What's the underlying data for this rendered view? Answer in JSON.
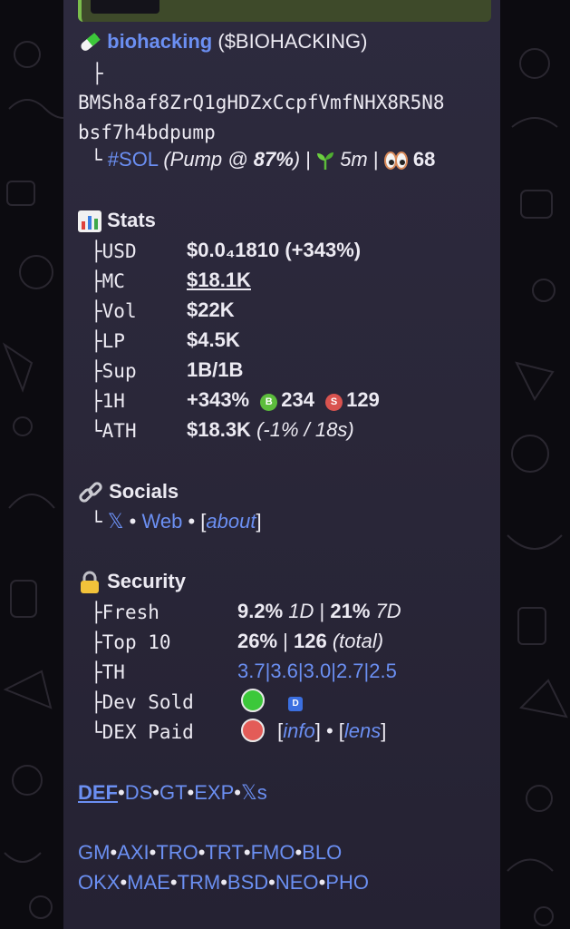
{
  "token": {
    "name": "biohacking",
    "ticker": "($BIOHACKING)",
    "address_line1": "BMSh8af8ZrQ1gHDZxCcpfVmfNHX8R5N8",
    "address_line2": "bsf7h4bdpump",
    "chain_tag": "#SOL",
    "pump_prefix": "(Pump @ ",
    "pump_pct": "87%",
    "pump_suffix": ")",
    "age": "5m",
    "eyes": "68",
    "sep": "|"
  },
  "stats": {
    "title": "Stats",
    "rows": [
      {
        "label": "USD",
        "value": "$0.0₄1810 (+343%)"
      },
      {
        "label": "MC",
        "value": "$18.1K"
      },
      {
        "label": "Vol",
        "value": "$22K"
      },
      {
        "label": "LP",
        "value": "$4.5K"
      },
      {
        "label": "Sup",
        "value": "1B/1B"
      },
      {
        "label": "1H",
        "value": "+343%",
        "buys": "234",
        "sells": "129",
        "buy_badge": "B",
        "sell_badge": "S"
      },
      {
        "label": "ATH",
        "value": "$18.3K",
        "value_note": "(-1% / 18s)"
      }
    ]
  },
  "socials": {
    "title": "Socials",
    "x": "𝕏",
    "web": "Web",
    "about": "about",
    "bullet": "•",
    "lb": "[",
    "rb": "]"
  },
  "security": {
    "title": "Security",
    "fresh_label": "Fresh",
    "fresh_1d": "9.2%",
    "fresh_1d_unit": "1D",
    "fresh_7d": "21%",
    "fresh_7d_unit": "7D",
    "top10_label": "Top 10",
    "top10_pct": "26%",
    "top10_total": "126",
    "top10_total_note": "(total)",
    "th_label": "TH",
    "th_values": [
      "3.7",
      "3.6",
      "3.0",
      "2.7",
      "2.5"
    ],
    "dev_sold_label": "Dev Sold",
    "dev_badge": "D",
    "dex_paid_label": "DEX Paid",
    "info": "info",
    "lens": "lens"
  },
  "links_row1": [
    "DEF",
    "DS",
    "GT",
    "EXP",
    "𝕏s"
  ],
  "links_row2": [
    "GM",
    "AXI",
    "TRO",
    "TRT",
    "FMO",
    "BLO"
  ],
  "links_row3": [
    "OKX",
    "MAE",
    "TRM",
    "BSD",
    "NEO",
    "PHO"
  ],
  "colors": {
    "link": "#6b8ff2",
    "bubble": "#2a2739",
    "green": "#3cc83a",
    "red": "#e35c58"
  }
}
